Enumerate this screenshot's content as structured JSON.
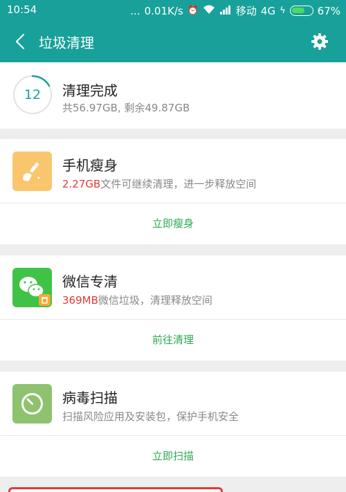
{
  "status": {
    "time": "10:54",
    "dots": "...",
    "speed": "0.01K/s",
    "carrier": "移动",
    "network": "4G",
    "battery_percent": "67%",
    "battery_level": 0.67
  },
  "header": {
    "title": "垃圾清理",
    "back_icon": "chevron-left-icon",
    "settings_icon": "gear-icon"
  },
  "summary": {
    "count": "12",
    "title": "清理完成",
    "subtitle": "共56.97GB, 剩余49.87GB"
  },
  "features": [
    {
      "title": "手机瘦身",
      "highlight": "2.27GB",
      "subtitle": "文件可继续清理，进一步释放空间",
      "action": "立即瘦身",
      "icon": "shovel-icon",
      "color": "#f9c66d"
    },
    {
      "title": "微信专清",
      "highlight": "369MB",
      "subtitle": "微信垃圾，清理释放空间",
      "action": "前往清理",
      "icon": "wechat-icon",
      "color": "#3ec346"
    },
    {
      "title": "病毒扫描",
      "highlight": "",
      "subtitle": "扫描风险应用及安装包，保护手机安全",
      "action": "立即扫描",
      "icon": "timer-scan-icon",
      "color": "#8fc26f"
    }
  ],
  "colors": {
    "primary": "#17a19a",
    "accent_green": "#2eaa52",
    "highlight_red": "#e53935"
  }
}
